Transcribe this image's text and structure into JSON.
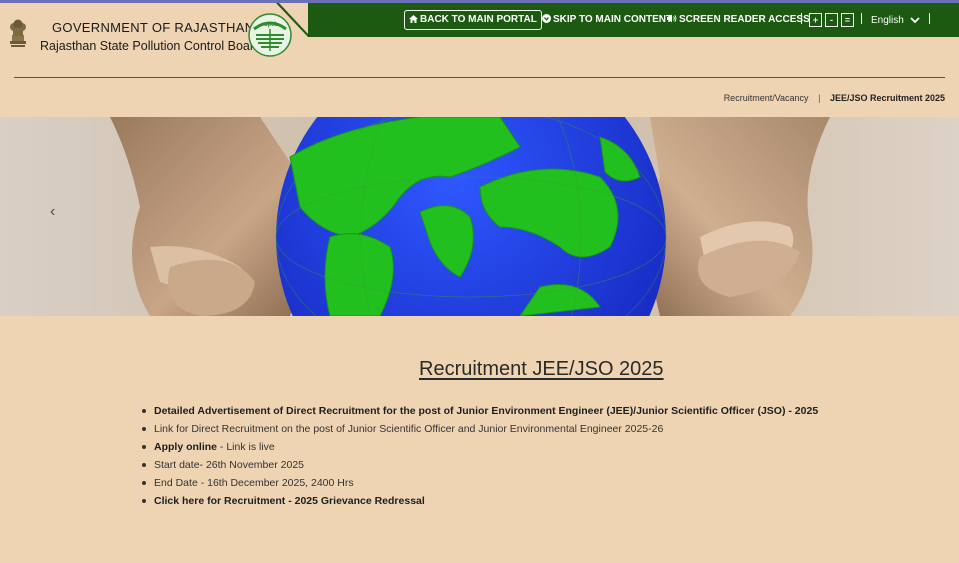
{
  "header": {
    "gov_title": "GOVERNMENT OF RAJASTHAN",
    "board_title": "Rajasthan State Pollution Control Board",
    "logo_text": "rspcb"
  },
  "topbar": {
    "back_label": "BACK TO MAIN PORTAL",
    "skip_label": "SKIP TO MAIN CONTENT",
    "screen_reader_label": "SCREEN READER ACCESS",
    "font_increase": "+",
    "font_decrease": "-",
    "font_reset": "=",
    "language": "English"
  },
  "breadcrumb": {
    "parent": "Recruitment/Vacancy",
    "separator": "|",
    "current": "JEE/JSO Recruitment 2025"
  },
  "banner": {
    "prev_arrow": "‹"
  },
  "main": {
    "title": "Recruitment JEE/JSO 2025",
    "items": [
      {
        "link": "Detailed Advertisement of Direct Recruitment for the post of Junior Environment Engineer (JEE)/Junior Scientific Officer (JSO) - 2025",
        "text": ""
      },
      {
        "link": "",
        "text": "Link for Direct Recruitment on the post of Junior Scientific Officer and Junior Environmental Engineer 2025-26"
      },
      {
        "link": "Apply online",
        "text": " - Link is live"
      },
      {
        "link": "",
        "text": "Start date- 26th November 2025"
      },
      {
        "link": "",
        "text": "End Date - 16th December 2025, 2400 Hrs"
      },
      {
        "link": "Click here for Recruitment - 2025 Grievance Redressal",
        "text": ""
      }
    ]
  },
  "colors": {
    "page_bg": "#efd4b4",
    "topbar_green": "#1c5a12",
    "globe_ocean": "#1f3fd6",
    "globe_land": "#22c01e"
  }
}
